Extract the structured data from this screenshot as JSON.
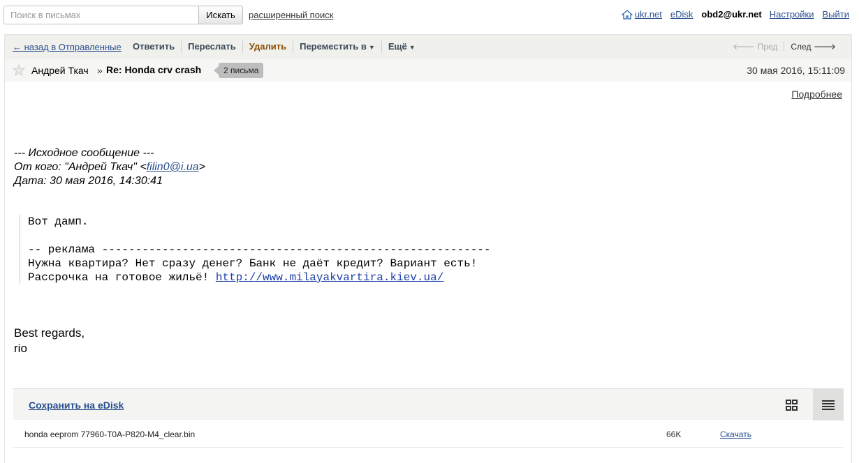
{
  "search": {
    "placeholder": "Поиск в письмах",
    "button": "Искать",
    "advanced": "расширенный поиск"
  },
  "topnav": {
    "home": "ukr.net",
    "edisk": "eDisk",
    "user": "obd2@ukr.net",
    "settings": "Настройки",
    "logout": "Выйти"
  },
  "toolbar": {
    "back": "← назад в Отправленные",
    "reply": "Ответить",
    "forward": "Переслать",
    "delete": "Удалить",
    "move": "Переместить в",
    "more": "Ещё",
    "prev": "Пред",
    "next": "След"
  },
  "message": {
    "from": "Андрей Ткач",
    "separator": "»",
    "subject": "Re: Honda crv crash",
    "thread_count": "2 письма",
    "date": "30 мая 2016, 15:11:09",
    "details": "Подробнее"
  },
  "quote_header": {
    "line1": "--- Исходное сообщение ---",
    "from_prefix": "От кого: \"Андрей Ткач\" <",
    "from_email": "filin0@i.ua",
    "from_suffix": ">",
    "date_line": "Дата: 30 мая 2016, 14:30:41"
  },
  "quote_body": {
    "line1": "Вот дамп.",
    "line2": "-- реклама ----------------------------------------------------------",
    "line3": "Нужна квартира? Нет сразу денег? Банк не даёт кредит? Вариант есть!",
    "line4_prefix": "Рассрочка на готовое жильё! ",
    "line4_link": "http://www.milayakvartira.kiev.ua/"
  },
  "signature": {
    "line1": "Best regards,",
    "line2": "rio"
  },
  "attachments": {
    "save_label": "Сохранить на eDisk",
    "files": [
      {
        "name": "honda eeprom 77960-T0A-P820-M4_clear.bin",
        "size": "66K",
        "download": "Скачать"
      }
    ]
  }
}
